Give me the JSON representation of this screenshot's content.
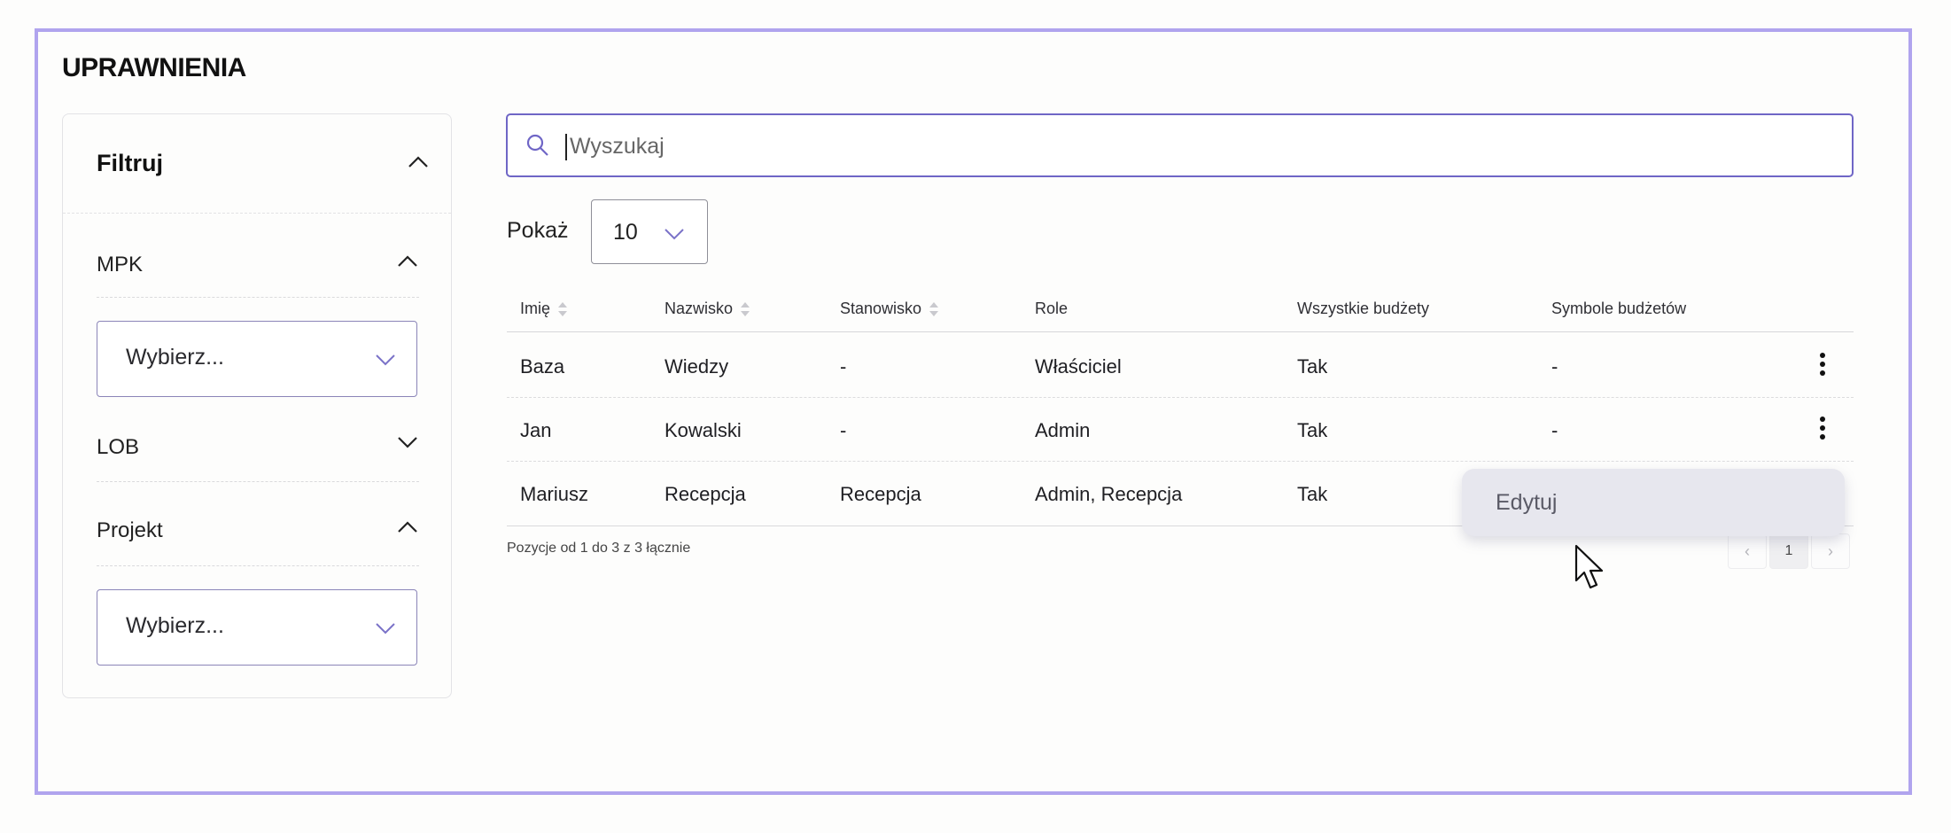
{
  "page": {
    "title": "UPRAWNIENIA"
  },
  "filters": {
    "title": "Filtruj",
    "sections": [
      {
        "label": "MPK",
        "expanded": true,
        "select_placeholder": "Wybierz..."
      },
      {
        "label": "LOB",
        "expanded": false
      },
      {
        "label": "Projekt",
        "expanded": true,
        "select_placeholder": "Wybierz..."
      }
    ]
  },
  "search": {
    "placeholder": "Wyszukaj",
    "value": ""
  },
  "page_size": {
    "label": "Pokaż",
    "value": "10"
  },
  "table": {
    "columns": [
      "Imię",
      "Nazwisko",
      "Stanowisko",
      "Role",
      "Wszystkie budżety",
      "Symbole budżetów"
    ],
    "sortable": [
      true,
      true,
      true,
      false,
      false,
      false
    ],
    "rows": [
      {
        "first_name": "Baza",
        "last_name": "Wiedzy",
        "position": "-",
        "roles": "Właściciel",
        "all_budgets": "Tak",
        "budget_symbols": "-"
      },
      {
        "first_name": "Jan",
        "last_name": "Kowalski",
        "position": "-",
        "roles": "Admin",
        "all_budgets": "Tak",
        "budget_symbols": "-"
      },
      {
        "first_name": "Mariusz",
        "last_name": "Recepcja",
        "position": "Recepcja",
        "roles": "Admin, Recepcja",
        "all_budgets": "Tak",
        "budget_symbols": ""
      }
    ],
    "footer_info": "Pozycje od 1 do 3 z 3 łącznie"
  },
  "pagination": {
    "prev": "‹",
    "current": "1",
    "next": "›"
  },
  "context_menu": {
    "items": [
      "Edytuj"
    ]
  },
  "icons": {
    "search": "search-icon",
    "chevron_up": "chevron-up-icon",
    "chevron_down": "chevron-down-icon",
    "sort": "sort-icon",
    "kebab": "more-vertical-icon",
    "cursor": "mouse-pointer-icon"
  },
  "colors": {
    "accent": "#6f66c6",
    "frame": "#b0a4ee",
    "menu_bg": "#e7e7ee"
  }
}
